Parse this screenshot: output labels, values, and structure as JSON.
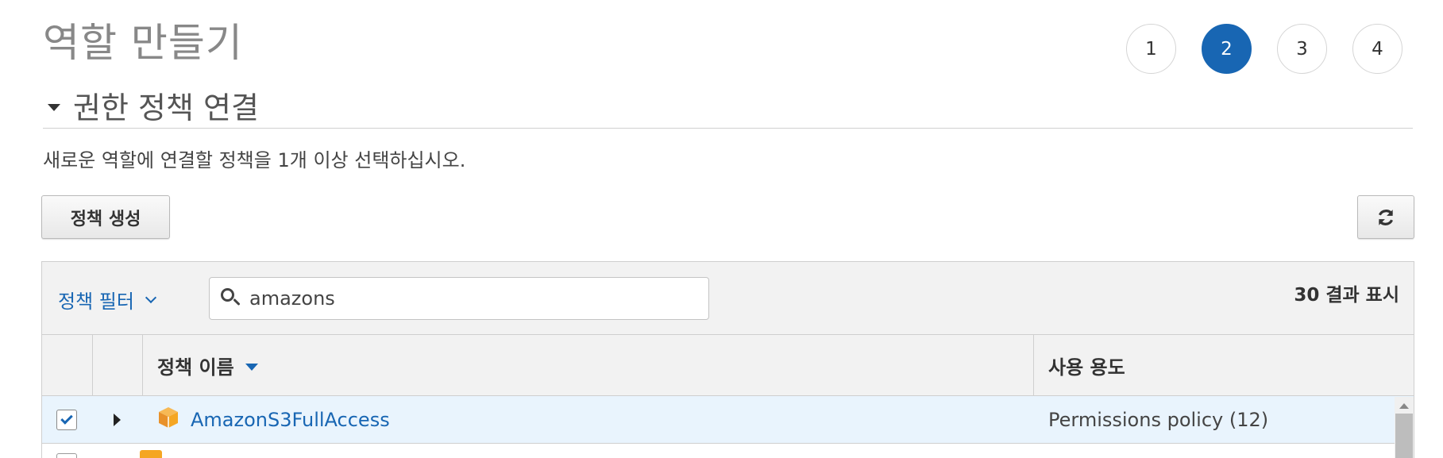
{
  "page": {
    "title": "역할 만들기"
  },
  "steps": [
    "1",
    "2",
    "3",
    "4"
  ],
  "active_step": "2",
  "section": {
    "title": "권한 정책 연결",
    "description": "새로운 역할에 연결할 정책을 1개 이상 선택하십시오."
  },
  "buttons": {
    "create_policy": "정책 생성",
    "refresh_icon": "refresh-icon"
  },
  "filter": {
    "label": "정책 필터",
    "search_value": "amazons",
    "result_count": "30 결과 표시"
  },
  "table": {
    "columns": [
      "정책 이름",
      "사용 용도"
    ],
    "rows": [
      {
        "name": "AmazonS3FullAccess",
        "usage": "Permissions policy (12)",
        "checked": true,
        "icon": "aws-managed-policy-icon"
      }
    ]
  },
  "colors": {
    "accent": "#1866b3",
    "selected_row": "#e9f4fd",
    "policy_icon": "#f5a623"
  }
}
